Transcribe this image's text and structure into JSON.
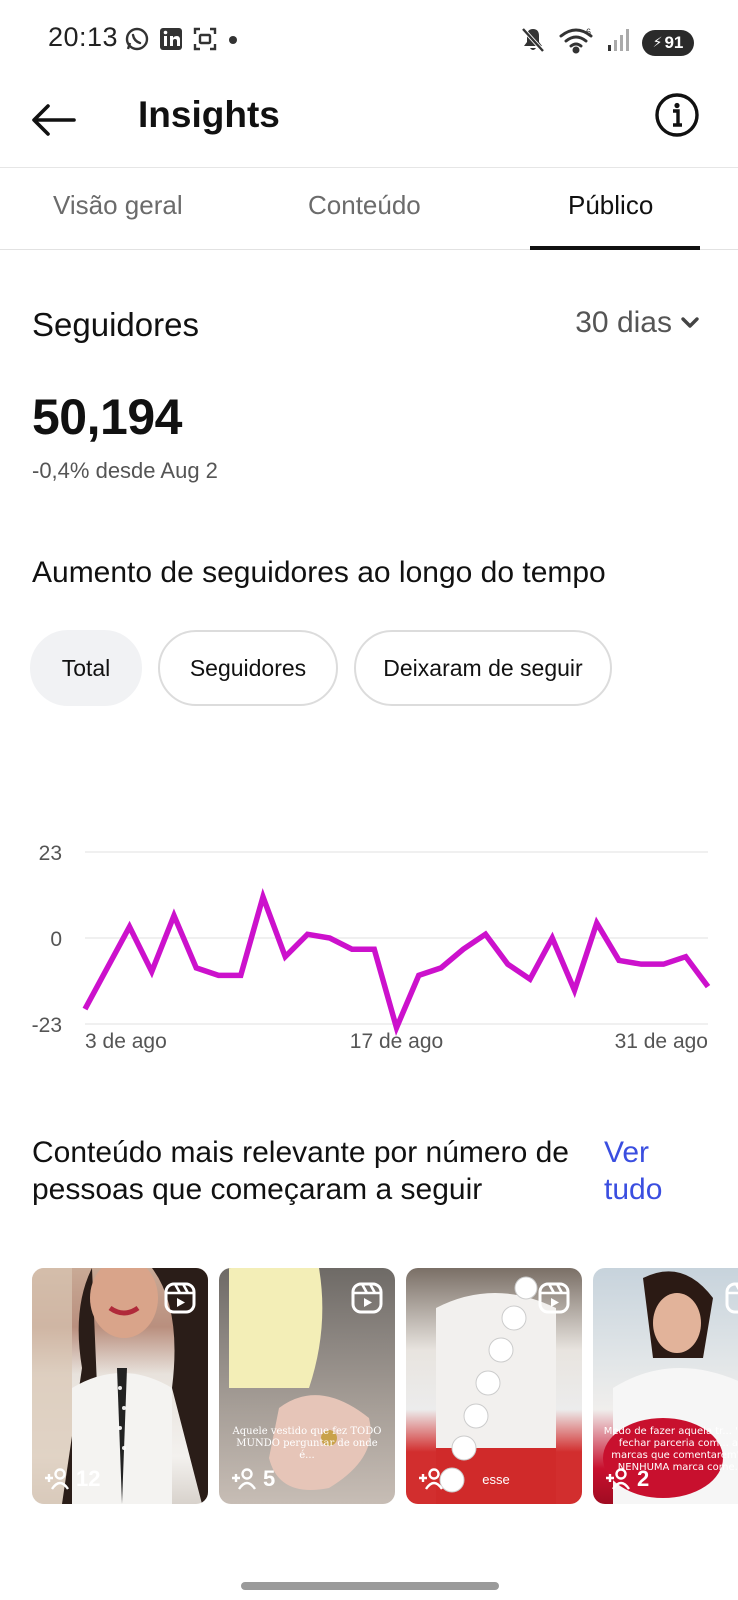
{
  "status_bar": {
    "time": "20:13",
    "battery": "91",
    "left_icons": [
      "whatsapp-icon",
      "linkedin-icon",
      "scan-icon",
      "dot-icon"
    ],
    "right_icons": [
      "mute-icon",
      "wifi-icon",
      "signal-icon",
      "battery-icon"
    ]
  },
  "header": {
    "title": "Insights"
  },
  "tabs": [
    {
      "label": "Visão geral",
      "active": false
    },
    {
      "label": "Conteúdo",
      "active": false
    },
    {
      "label": "Público",
      "active": true
    }
  ],
  "followers": {
    "title": "Seguidores",
    "period": "30 dias",
    "count": "50,194",
    "delta": "-0,4% desde Aug 2"
  },
  "growth": {
    "title": "Aumento de seguidores ao longo do tempo",
    "filters": [
      {
        "label": "Total",
        "active": true
      },
      {
        "label": "Seguidores",
        "active": false
      },
      {
        "label": "Deixaram de seguir",
        "active": false
      }
    ]
  },
  "chart_data": {
    "type": "line",
    "title": "",
    "xlabel": "",
    "ylabel": "",
    "ylim": [
      -23,
      23
    ],
    "y_ticks": [
      "23",
      "0",
      "-23"
    ],
    "x_tick_labels": [
      "3 de ago",
      "17 de ago",
      "31 de ago"
    ],
    "grid": true,
    "line_color": "#cc11cc",
    "x": [
      "3 de ago",
      "4 de ago",
      "5 de ago",
      "6 de ago",
      "7 de ago",
      "8 de ago",
      "9 de ago",
      "10 de ago",
      "11 de ago",
      "12 de ago",
      "13 de ago",
      "14 de ago",
      "15 de ago",
      "16 de ago",
      "17 de ago",
      "18 de ago",
      "19 de ago",
      "20 de ago",
      "21 de ago",
      "22 de ago",
      "23 de ago",
      "24 de ago",
      "25 de ago",
      "26 de ago",
      "27 de ago",
      "28 de ago",
      "29 de ago",
      "30 de ago",
      "31 de ago"
    ],
    "series": [
      {
        "values": [
          -19,
          -8,
          3,
          -9,
          6,
          -8,
          -10,
          -10,
          11,
          -5,
          1,
          0,
          -3,
          -3,
          -24,
          -10,
          -8,
          -3,
          1,
          -7,
          -11,
          0,
          -14,
          4,
          -6,
          -7,
          -7,
          -5,
          -13
        ]
      }
    ]
  },
  "top_content": {
    "title": "Conteúdo mais relevante por número de pessoas que começaram a seguir",
    "see_all": "Ver tudo",
    "items": [
      {
        "count": "12",
        "caption": ""
      },
      {
        "count": "5",
        "caption": "Aquele vestido que fez TODO MUNDO perguntar de onde é..."
      },
      {
        "count": "3",
        "caption": "esse"
      },
      {
        "count": "2",
        "caption": "Medo de fazer aquela tr... \"Vou fechar parceria com... as marcas que comentarem\" E NENHUMA marca come..."
      }
    ]
  }
}
